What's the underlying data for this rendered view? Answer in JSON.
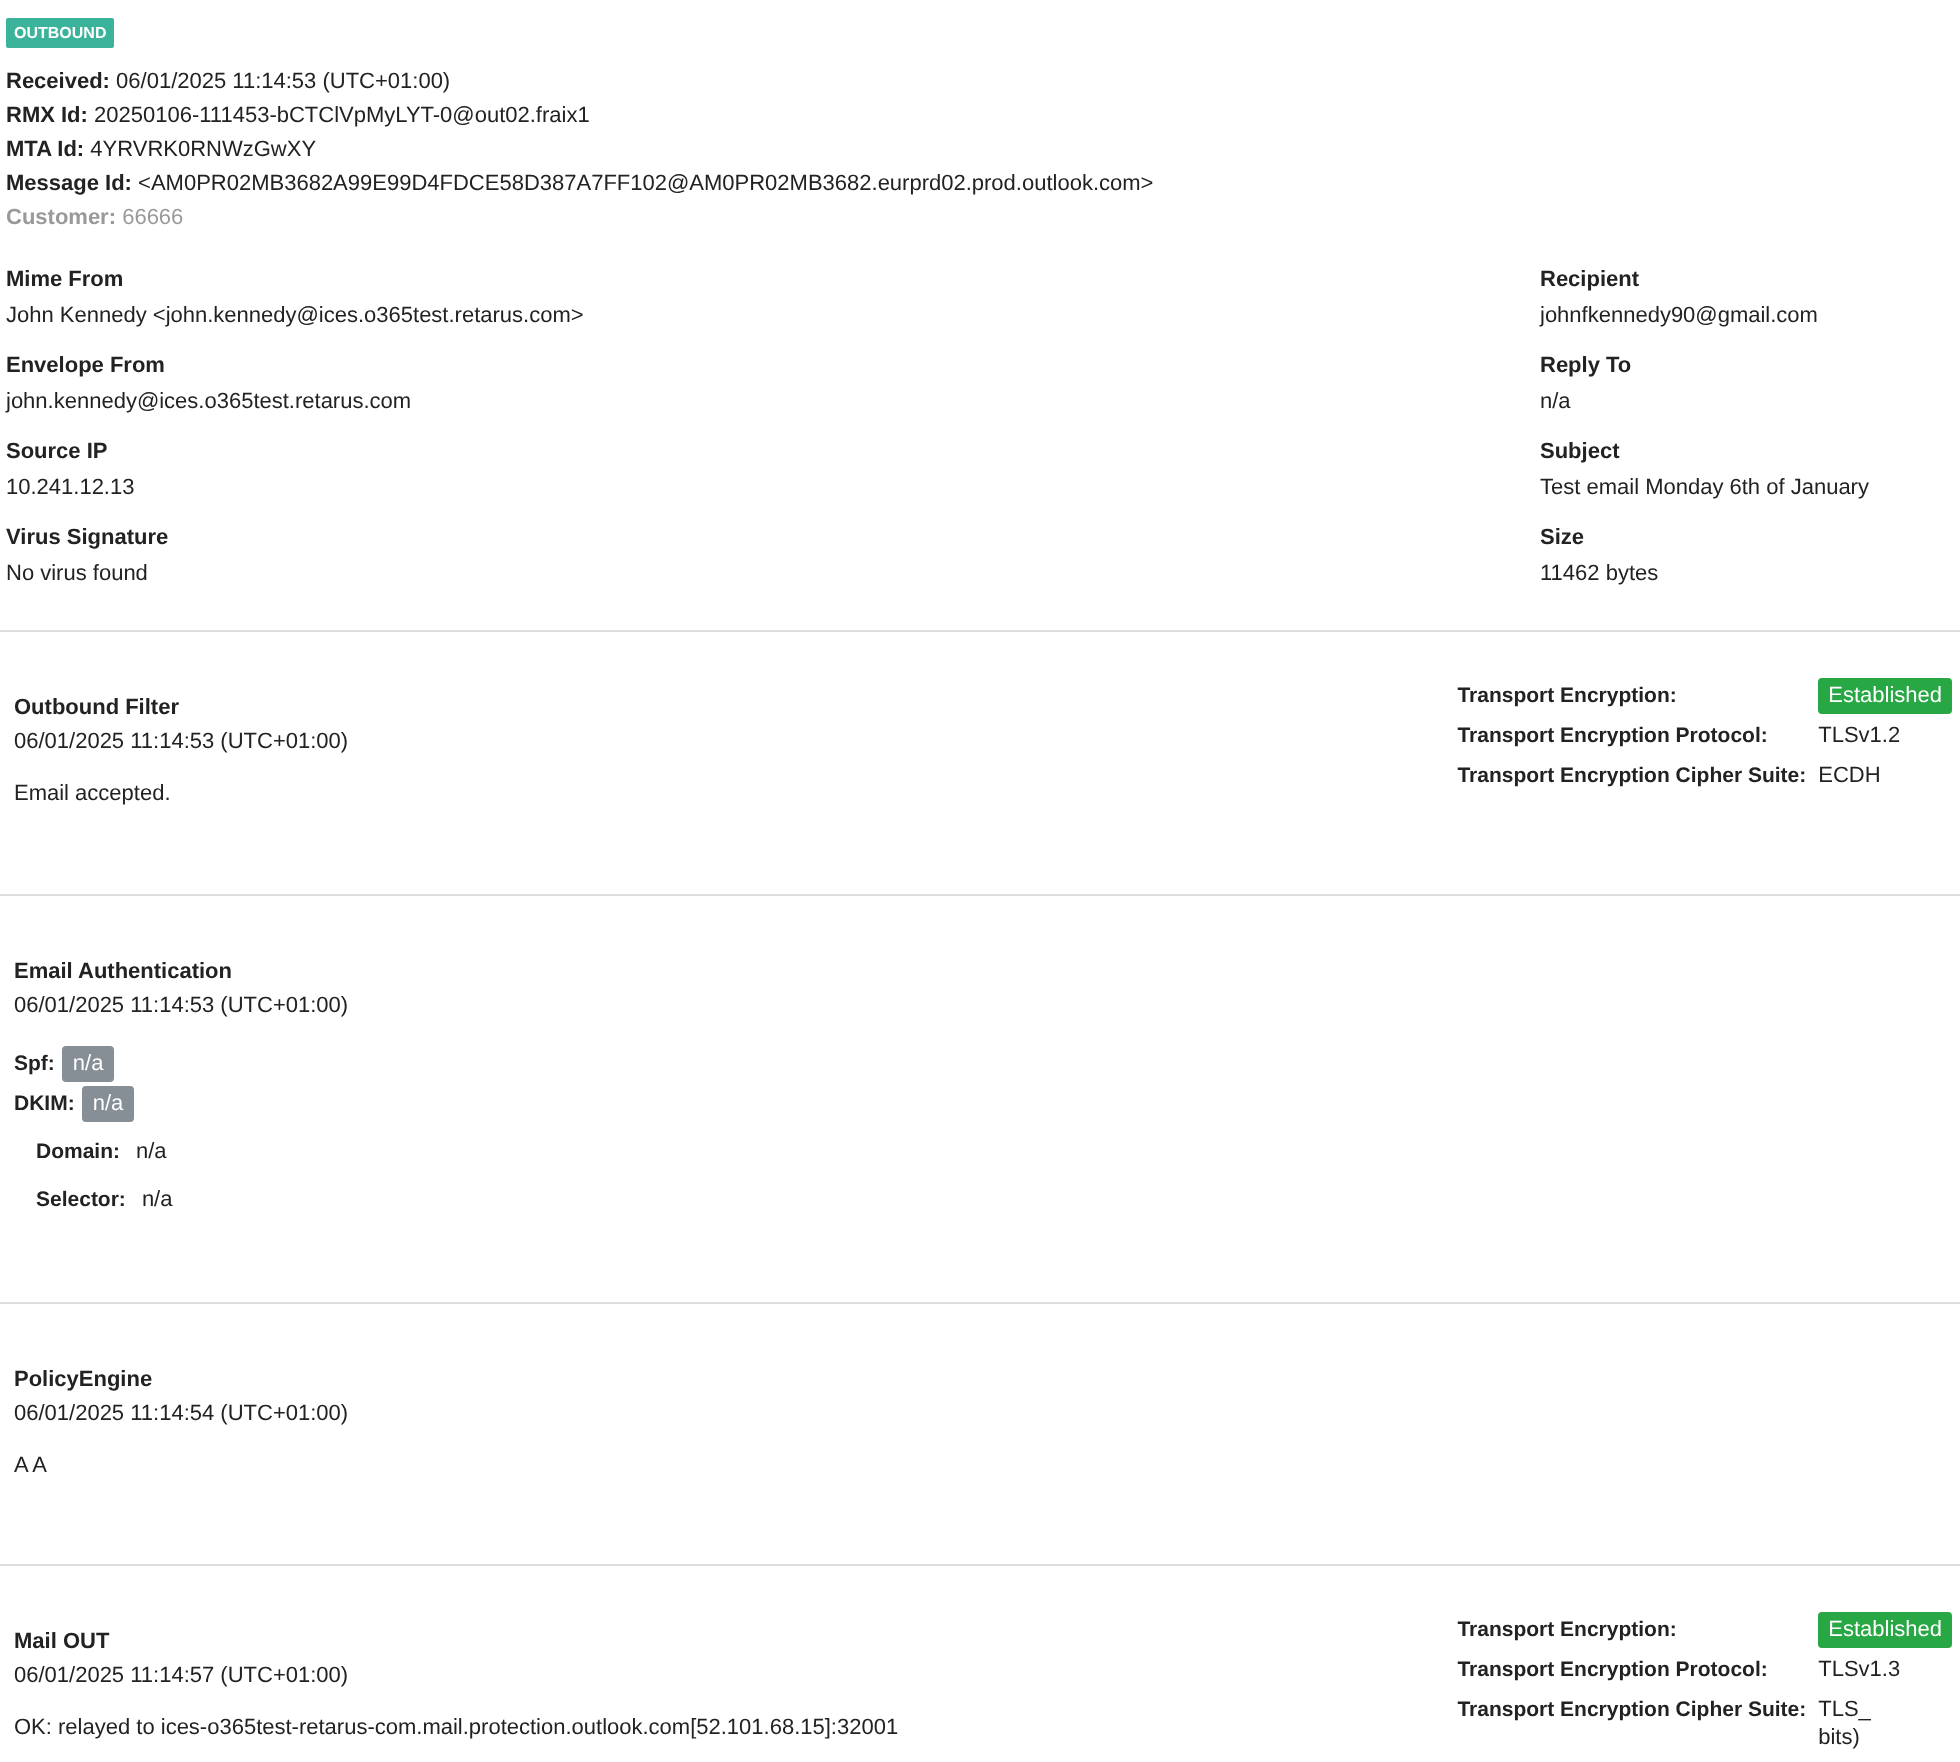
{
  "direction_badge": "OUTBOUND",
  "header": [
    {
      "label": "Received:",
      "value": "06/01/2025 11:14:53 (UTC+01:00)",
      "muted": false
    },
    {
      "label": "RMX Id:",
      "value": "20250106-111453-bCTClVpMyLYT-0@out02.fraix1",
      "muted": false
    },
    {
      "label": "MTA Id:",
      "value": "4YRVRK0RNWzGwXY",
      "muted": false
    },
    {
      "label": "Message Id:",
      "value": "<AM0PR02MB3682A99E99D4FDCE58D387A7FF102@AM0PR02MB3682.eurprd02.prod.outlook.com>",
      "muted": false
    },
    {
      "label": "Customer:",
      "value": "66666",
      "muted": true
    }
  ],
  "fields_left": [
    {
      "label": "Mime From",
      "value": "John Kennedy <john.kennedy@ices.o365test.retarus.com>"
    },
    {
      "label": "Envelope From",
      "value": "john.kennedy@ices.o365test.retarus.com"
    },
    {
      "label": "Source IP",
      "value": "10.241.12.13"
    },
    {
      "label": "Virus Signature",
      "value": "No virus found"
    }
  ],
  "fields_right": [
    {
      "label": "Recipient",
      "value": "johnfkennedy90@gmail.com"
    },
    {
      "label": "Reply To",
      "value": "n/a"
    },
    {
      "label": "Subject",
      "value": "Test email Monday 6th of January"
    },
    {
      "label": "Size",
      "value": "11462 bytes"
    }
  ],
  "events": [
    {
      "title": "Outbound Filter",
      "time": "06/01/2025 11:14:53 (UTC+01:00)",
      "message": "Email accepted.",
      "transport": {
        "encryption_label": "Transport Encryption:",
        "encryption_status": "Established",
        "protocol_label": "Transport Encryption Protocol:",
        "protocol": "TLSv1.2",
        "cipher_label": "Transport Encryption Cipher Suite:",
        "cipher_lines": [
          "ECDH"
        ]
      }
    },
    {
      "title": "Email Authentication",
      "time": "06/01/2025 11:14:53 (UTC+01:00)",
      "auth": {
        "spf_label": "Spf:",
        "spf": "n/a",
        "dkim_label": "DKIM:",
        "dkim": "n/a",
        "details": [
          {
            "label": "Domain:",
            "value": "n/a"
          },
          {
            "label": "Selector:",
            "value": "n/a"
          }
        ]
      }
    },
    {
      "title": "PolicyEngine",
      "time": "06/01/2025 11:14:54 (UTC+01:00)",
      "message": "A A"
    },
    {
      "title": "Mail OUT",
      "time": "06/01/2025 11:14:57 (UTC+01:00)",
      "message": "OK: relayed to ices-o365test-retarus-com.mail.protection.outlook.com[52.101.68.15]:32001",
      "transport": {
        "encryption_label": "Transport Encryption:",
        "encryption_status": "Established",
        "protocol_label": "Transport Encryption Protocol:",
        "protocol": "TLSv1.3",
        "cipher_label": "Transport Encryption Cipher Suite:",
        "cipher_lines": [
          "TLS_",
          "bits)"
        ]
      }
    }
  ]
}
